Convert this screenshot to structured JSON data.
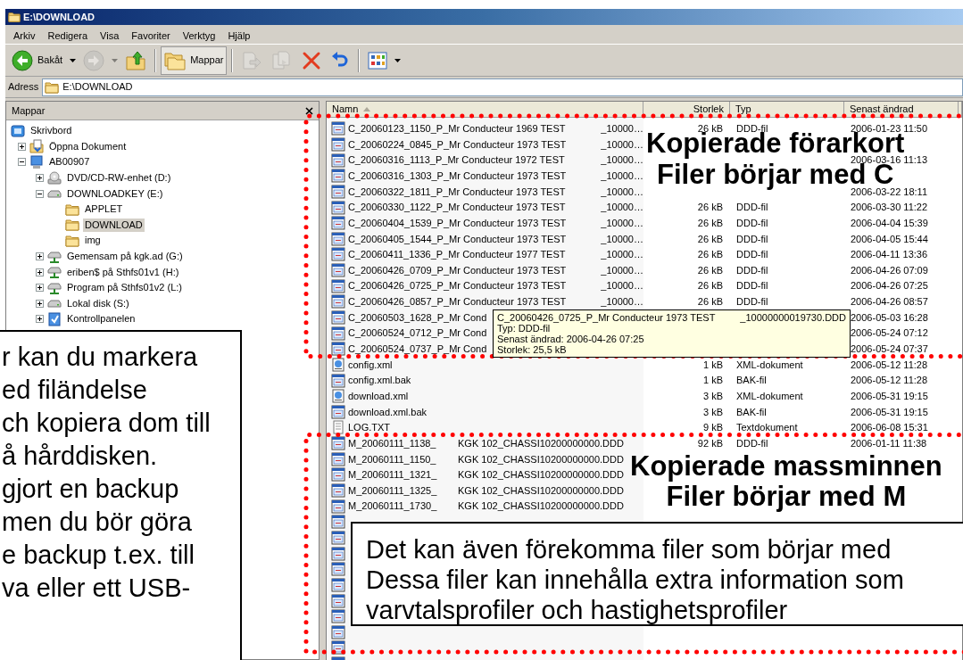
{
  "window": {
    "title": "E:\\DOWNLOAD"
  },
  "menu": [
    "Arkiv",
    "Redigera",
    "Visa",
    "Favoriter",
    "Verktyg",
    "Hjälp"
  ],
  "toolbar": [
    [
      {
        "kind": "back",
        "label": "Bakåt",
        "disabled": false,
        "pressed": false
      },
      {
        "kind": "forward",
        "disabled": true,
        "pressed": false
      },
      {
        "kind": "up",
        "disabled": false,
        "pressed": false
      }
    ],
    [
      {
        "kind": "folders",
        "label": "Mappar",
        "disabled": false,
        "pressed": true
      }
    ],
    [
      {
        "kind": "move",
        "disabled": true,
        "pressed": false
      },
      {
        "kind": "copy",
        "disabled": true,
        "pressed": false
      },
      {
        "kind": "delete",
        "disabled": false,
        "pressed": false
      },
      {
        "kind": "undo",
        "disabled": false,
        "pressed": false
      }
    ],
    [
      {
        "kind": "views",
        "disabled": false,
        "pressed": false
      }
    ]
  ],
  "address": {
    "label": "Adress",
    "value": "E:\\DOWNLOAD"
  },
  "folders_pane": {
    "title": "Mappar"
  },
  "tree": [
    {
      "label": "Skrivbord",
      "kind": "desktop",
      "selected": false,
      "children": [
        {
          "label": "Öppna Dokument",
          "kind": "documents",
          "expanded": false,
          "selected": false
        },
        {
          "label": "AB00907",
          "kind": "computer",
          "expanded": true,
          "selected": false,
          "children": [
            {
              "label": "DVD/CD-RW-enhet (D:)",
              "kind": "cd",
              "expanded": false,
              "selected": false
            },
            {
              "label": "DOWNLOADKEY (E:)",
              "kind": "drive",
              "expanded": true,
              "selected": false,
              "children": [
                {
                  "label": "APPLET",
                  "kind": "folder",
                  "selected": false
                },
                {
                  "label": "DOWNLOAD",
                  "kind": "folder",
                  "selected": true
                },
                {
                  "label": "img",
                  "kind": "folder",
                  "selected": false
                }
              ]
            },
            {
              "label": "Gemensam på kgk.ad (G:)",
              "kind": "network",
              "expanded": false,
              "selected": false
            },
            {
              "label": "eriben$ på Sthfs01v1 (H:)",
              "kind": "network",
              "expanded": false,
              "selected": false
            },
            {
              "label": "Program på Sthfs01v2 (L:)",
              "kind": "network",
              "expanded": false,
              "selected": false
            },
            {
              "label": "Lokal disk (S:)",
              "kind": "drive",
              "expanded": false,
              "selected": false
            },
            {
              "label": "Kontrollpanelen",
              "kind": "control",
              "expanded": false,
              "selected": false
            }
          ]
        }
      ]
    }
  ],
  "columns": [
    {
      "label": "Namn",
      "sorted": true
    },
    {
      "label": "Storlek",
      "sorted": false
    },
    {
      "label": "Typ",
      "sorted": false
    },
    {
      "label": "Senast ändrad",
      "sorted": false
    }
  ],
  "rows": [
    {
      "kind": "card",
      "name": "C_20060123_1150_P_Mr Conducteur 1969 TEST",
      "tail": "_10000…",
      "size": "26 kB",
      "type": "DDD-fil",
      "modified": "2006-01-23 11:50"
    },
    {
      "kind": "card",
      "name": "C_20060224_0845_P_Mr Conducteur 1973 TEST",
      "tail": "_10000…"
    },
    {
      "kind": "card",
      "name": "C_20060316_1113_P_Mr Conducteur 1972 TEST",
      "tail": "_10000…",
      "modified": "2006-03-16 11:13"
    },
    {
      "kind": "card",
      "name": "C_20060316_1303_P_Mr Conducteur 1973 TEST",
      "tail": "_10000…"
    },
    {
      "kind": "card",
      "name": "C_20060322_1811_P_Mr Conducteur 1973 TEST",
      "tail": "_10000…",
      "modified": "2006-03-22 18:11"
    },
    {
      "kind": "card",
      "name": "C_20060330_1122_P_Mr Conducteur 1973 TEST",
      "tail": "_10000…",
      "size": "26 kB",
      "type": "DDD-fil",
      "modified": "2006-03-30 11:22"
    },
    {
      "kind": "card",
      "name": "C_20060404_1539_P_Mr Conducteur 1973 TEST",
      "tail": "_10000…",
      "size": "26 kB",
      "type": "DDD-fil",
      "modified": "2006-04-04 15:39"
    },
    {
      "kind": "card",
      "name": "C_20060405_1544_P_Mr Conducteur 1973 TEST",
      "tail": "_10000…",
      "size": "26 kB",
      "type": "DDD-fil",
      "modified": "2006-04-05 15:44"
    },
    {
      "kind": "card",
      "name": "C_20060411_1336_P_Mr Conducteur 1977 TEST",
      "tail": "_10000…",
      "size": "26 kB",
      "type": "DDD-fil",
      "modified": "2006-04-11 13:36"
    },
    {
      "kind": "card",
      "name": "C_20060426_0709_P_Mr Conducteur 1973 TEST",
      "tail": "_10000…",
      "size": "26 kB",
      "type": "DDD-fil",
      "modified": "2006-04-26 07:09"
    },
    {
      "kind": "card",
      "name": "C_20060426_0725_P_Mr Conducteur 1973 TEST",
      "tail": "_10000…",
      "size": "26 kB",
      "type": "DDD-fil",
      "modified": "2006-04-26 07:25"
    },
    {
      "kind": "card",
      "name": "C_20060426_0857_P_Mr Conducteur 1973 TEST",
      "tail": "_10000…",
      "size": "26 kB",
      "type": "DDD-fil",
      "modified": "2006-04-26 08:57"
    },
    {
      "kind": "card",
      "name": "C_20060503_1628_P_Mr Cond",
      "modified": "2006-05-03 16:28"
    },
    {
      "kind": "card",
      "name": "C_20060524_0712_P_Mr Cond",
      "modified": "2006-05-24 07:12"
    },
    {
      "kind": "card",
      "name": "C_20060524_0737_P_Mr Cond",
      "modified": "2006-05-24 07:37"
    },
    {
      "kind": "xml",
      "name": "config.xml",
      "size": "1 kB",
      "type": "XML-dokument",
      "modified": "2006-05-12 11:28"
    },
    {
      "kind": "bak",
      "name": "config.xml.bak",
      "size": "1 kB",
      "type": "BAK-fil",
      "modified": "2006-05-12 11:28"
    },
    {
      "kind": "xml",
      "name": "download.xml",
      "size": "3 kB",
      "type": "XML-dokument",
      "modified": "2006-05-31 19:15"
    },
    {
      "kind": "bak",
      "name": "download.xml.bak",
      "size": "3 kB",
      "type": "BAK-fil",
      "modified": "2006-05-31 19:15"
    },
    {
      "kind": "txt",
      "name": "LOG.TXT",
      "size": "9 kB",
      "type": "Textdokument",
      "modified": "2006-06-08 15:31"
    },
    {
      "kind": "mass",
      "name": "M_20060111_1138_",
      "tail": "KGK 102_CHASSI10200000000.DDD",
      "size": "92 kB",
      "type": "DDD-fil",
      "modified": "2006-01-11 11:38"
    },
    {
      "kind": "mass",
      "name": "M_20060111_1150_",
      "tail": "KGK 102_CHASSI10200000000.DDD"
    },
    {
      "kind": "mass",
      "name": "M_20060111_1321_",
      "tail": "KGK 102_CHASSI10200000000.DDD"
    },
    {
      "kind": "mass",
      "name": "M_20060111_1325_",
      "tail": "KGK 102_CHASSI10200000000.DDD"
    },
    {
      "kind": "mass",
      "name": "M_20060111_1730_",
      "tail": "KGK 102_CHASSI10200000000.DDD"
    },
    {
      "kind": "mass"
    },
    {
      "kind": "mass"
    },
    {
      "kind": "mass"
    },
    {
      "kind": "mass"
    },
    {
      "kind": "mass"
    },
    {
      "kind": "mass"
    },
    {
      "kind": "mass"
    },
    {
      "kind": "mass"
    },
    {
      "kind": "mass"
    },
    {
      "kind": "mass"
    }
  ],
  "tooltip": {
    "name": "C_20060426_0725_P_Mr Conducteur 1973 TEST",
    "tail": "_10000000019730.DDD",
    "lines": [
      "Typ: DDD-fil",
      "Senast ändrad: 2006-04-26 07:25",
      "Storlek: 25,5 kB"
    ]
  },
  "annotations": [
    {
      "lines": [
        "Kopierade förarkort",
        "Filer börjar med C"
      ]
    },
    {
      "lines": [
        "Kopierade massminnen",
        "Filer börjar med M"
      ]
    }
  ],
  "callouts": [
    {
      "lines": [
        "r kan du markera",
        "ed filändelse",
        "ch kopiera dom till",
        "å hårddisken.",
        "gjort en backup",
        "men du bör göra",
        "e backup t.ex. till",
        "va eller ett USB-"
      ]
    },
    {
      "lines": [
        "Det kan även förekomma filer som börjar med",
        "Dessa filer kan innehålla extra information som",
        "varvtalsprofiler och hastighetsprofiler"
      ]
    }
  ]
}
